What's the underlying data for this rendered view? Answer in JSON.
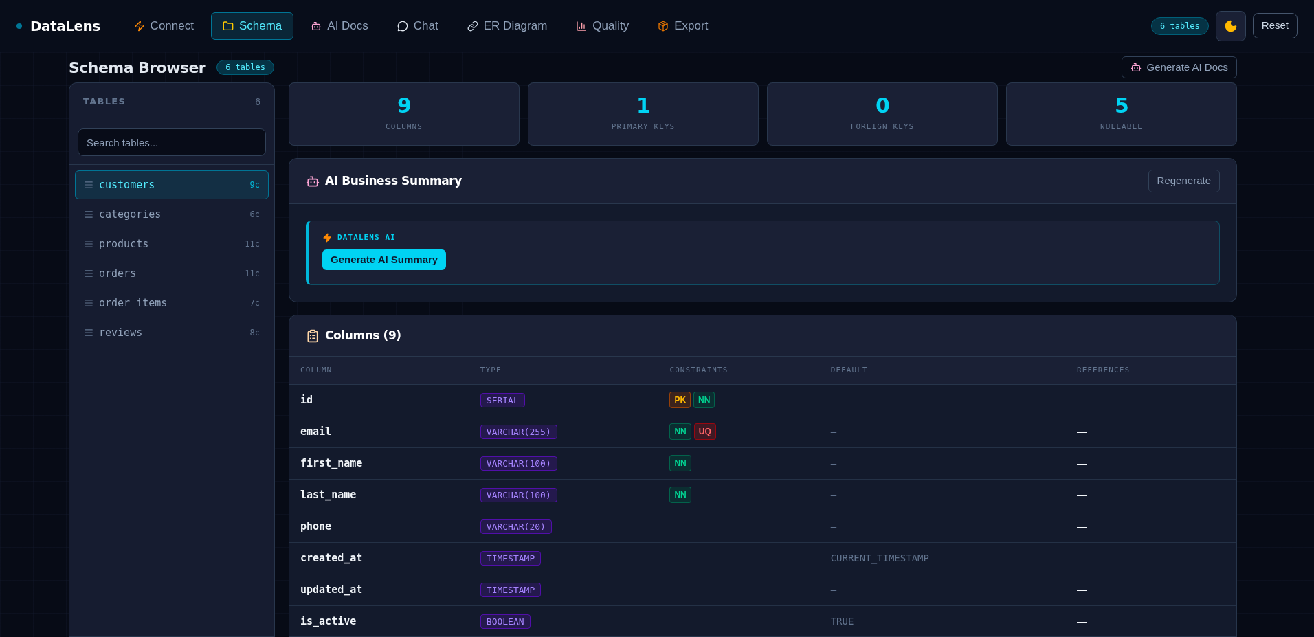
{
  "brand": "DataLens",
  "tabs": [
    {
      "label": "Connect",
      "kind": "connect",
      "selected": false
    },
    {
      "label": "Schema",
      "kind": "schema",
      "selected": true
    },
    {
      "label": "AI Docs",
      "kind": "docs",
      "selected": false
    },
    {
      "label": "Chat",
      "kind": "chat",
      "selected": false
    },
    {
      "label": "ER Diagram",
      "kind": "diagram",
      "selected": false
    },
    {
      "label": "Quality",
      "kind": "quality",
      "selected": false
    },
    {
      "label": "Export",
      "kind": "export",
      "selected": false
    }
  ],
  "header_badge": "6 tables",
  "reset_button": "Reset",
  "page_title": "Schema Browser",
  "page_badge": "6 tables",
  "generate_docs_button": "Generate AI Docs",
  "sidebar": {
    "title": "TABLES",
    "count": "6",
    "search": {
      "placeholder": "Search tables..."
    },
    "items": [
      {
        "name": "customers",
        "count": "9c",
        "selected": true
      },
      {
        "name": "categories",
        "count": "6c",
        "selected": false
      },
      {
        "name": "products",
        "count": "11c",
        "selected": false
      },
      {
        "name": "orders",
        "count": "11c",
        "selected": false
      },
      {
        "name": "order_items",
        "count": "7c",
        "selected": false
      },
      {
        "name": "reviews",
        "count": "8c",
        "selected": false
      }
    ]
  },
  "stats": [
    {
      "value": "9",
      "label": "COLUMNS"
    },
    {
      "value": "1",
      "label": "PRIMARY KEYS"
    },
    {
      "value": "0",
      "label": "FOREIGN KEYS"
    },
    {
      "value": "5",
      "label": "NULLABLE"
    }
  ],
  "summary": {
    "title": "AI Business Summary",
    "regenerate_button": "Regenerate",
    "ai_label": "DATALENS AI",
    "generate_button": "Generate AI Summary"
  },
  "columns_card": {
    "title": "Columns (9)",
    "headers": [
      "COLUMN",
      "TYPE",
      "CONSTRAINTS",
      "DEFAULT",
      "REFERENCES"
    ],
    "rows": [
      {
        "name": "id",
        "type": "SERIAL",
        "constraints": [
          {
            "label": "PK",
            "kind": "pk"
          },
          {
            "label": "NN",
            "kind": "nn"
          }
        ],
        "default": "—",
        "references": "—"
      },
      {
        "name": "email",
        "type": "VARCHAR(255)",
        "constraints": [
          {
            "label": "NN",
            "kind": "nn"
          },
          {
            "label": "UQ",
            "kind": "uq"
          }
        ],
        "default": "—",
        "references": "—"
      },
      {
        "name": "first_name",
        "type": "VARCHAR(100)",
        "constraints": [
          {
            "label": "NN",
            "kind": "nn"
          }
        ],
        "default": "—",
        "references": "—"
      },
      {
        "name": "last_name",
        "type": "VARCHAR(100)",
        "constraints": [
          {
            "label": "NN",
            "kind": "nn"
          }
        ],
        "default": "—",
        "references": "—"
      },
      {
        "name": "phone",
        "type": "VARCHAR(20)",
        "default": "—",
        "references": "—"
      },
      {
        "name": "created_at",
        "type": "TIMESTAMP",
        "default": "CURRENT_TIMESTAMP",
        "references": "—"
      },
      {
        "name": "updated_at",
        "type": "TIMESTAMP",
        "default": "—",
        "references": "—"
      },
      {
        "name": "is_active",
        "type": "BOOLEAN",
        "default": "TRUE",
        "references": "—"
      }
    ]
  }
}
